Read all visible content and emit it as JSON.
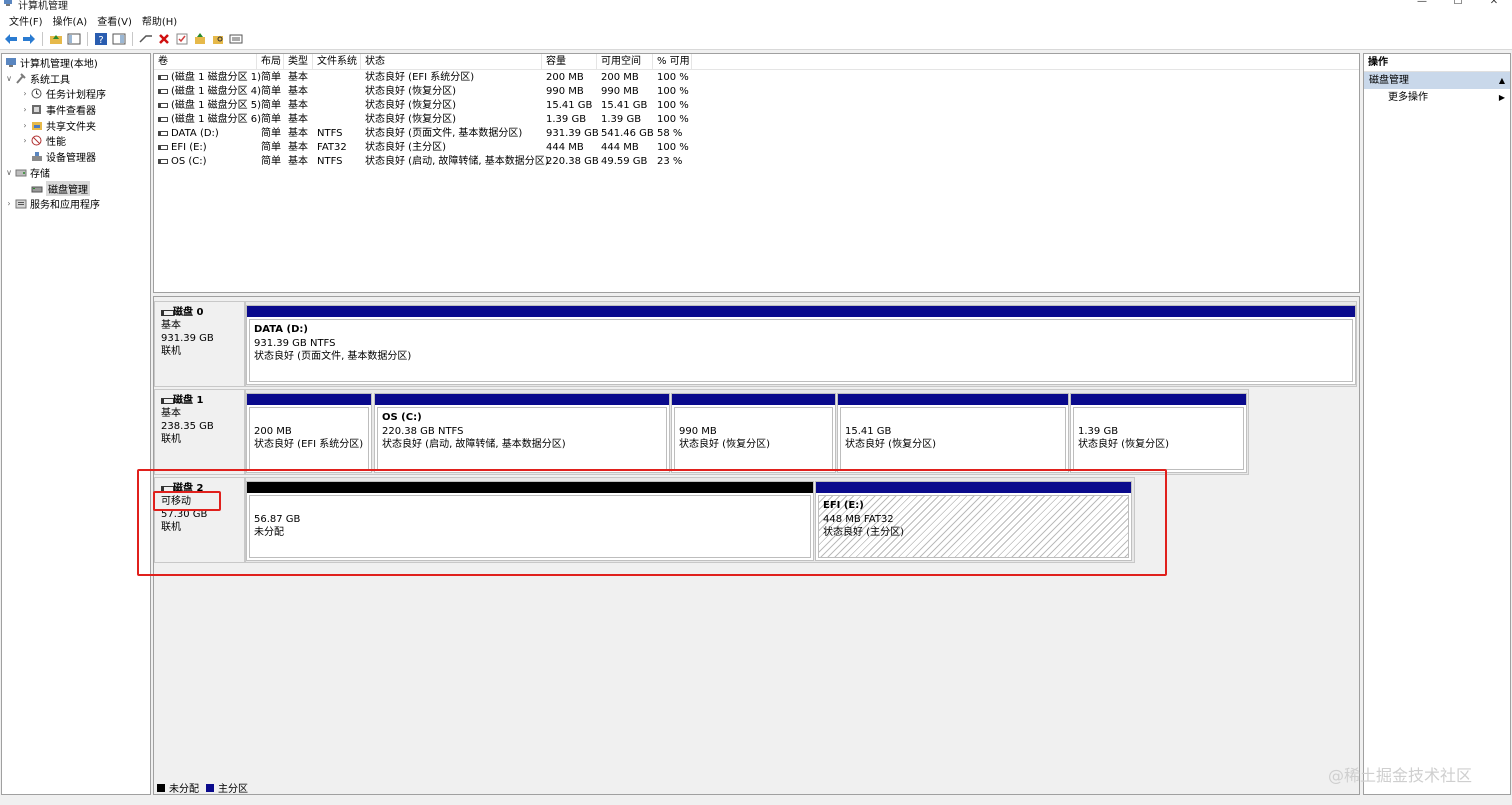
{
  "window": {
    "title": "计算机管理",
    "controls": [
      "—",
      "☐",
      "✕"
    ]
  },
  "menu": [
    "文件(F)",
    "操作(A)",
    "查看(V)",
    "帮助(H)"
  ],
  "tree": {
    "root": "计算机管理(本地)",
    "system_tools": "系统工具",
    "task_scheduler": "任务计划程序",
    "event_viewer": "事件查看器",
    "shared_folders": "共享文件夹",
    "performance": "性能",
    "device_manager": "设备管理器",
    "storage": "存储",
    "disk_management": "磁盘管理",
    "services_apps": "服务和应用程序"
  },
  "volumes": {
    "headers": [
      "卷",
      "布局",
      "类型",
      "文件系统",
      "状态",
      "容量",
      "可用空间",
      "% 可用"
    ],
    "rows": [
      [
        "(磁盘 1 磁盘分区 1)",
        "简单",
        "基本",
        "",
        "状态良好 (EFI 系统分区)",
        "200 MB",
        "200 MB",
        "100 %"
      ],
      [
        "(磁盘 1 磁盘分区 4)",
        "简单",
        "基本",
        "",
        "状态良好 (恢复分区)",
        "990 MB",
        "990 MB",
        "100 %"
      ],
      [
        "(磁盘 1 磁盘分区 5)",
        "简单",
        "基本",
        "",
        "状态良好 (恢复分区)",
        "15.41 GB",
        "15.41 GB",
        "100 %"
      ],
      [
        "(磁盘 1 磁盘分区 6)",
        "简单",
        "基本",
        "",
        "状态良好 (恢复分区)",
        "1.39 GB",
        "1.39 GB",
        "100 %"
      ],
      [
        "DATA (D:)",
        "简单",
        "基本",
        "NTFS",
        "状态良好 (页面文件, 基本数据分区)",
        "931.39 GB",
        "541.46 GB",
        "58 %"
      ],
      [
        "EFI (E:)",
        "简单",
        "基本",
        "FAT32",
        "状态良好 (主分区)",
        "444 MB",
        "444 MB",
        "100 %"
      ],
      [
        "OS (C:)",
        "简单",
        "基本",
        "NTFS",
        "状态良好 (启动, 故障转储, 基本数据分区)",
        "220.38 GB",
        "49.59 GB",
        "23 %"
      ]
    ]
  },
  "disks": {
    "disk0": {
      "name": "磁盘 0",
      "type": "基本",
      "size": "931.39 GB",
      "status": "联机",
      "parts": [
        {
          "name": "DATA  (D:)",
          "size": "931.39 GB NTFS",
          "status": "状态良好 (页面文件, 基本数据分区)"
        }
      ]
    },
    "disk1": {
      "name": "磁盘 1",
      "type": "基本",
      "size": "238.35 GB",
      "status": "联机",
      "parts": [
        {
          "name": "",
          "size": "200 MB",
          "status": "状态良好 (EFI 系统分区)"
        },
        {
          "name": "OS  (C:)",
          "size": "220.38 GB NTFS",
          "status": "状态良好 (启动, 故障转储, 基本数据分区)"
        },
        {
          "name": "",
          "size": "990 MB",
          "status": "状态良好 (恢复分区)"
        },
        {
          "name": "",
          "size": "15.41 GB",
          "status": "状态良好 (恢复分区)"
        },
        {
          "name": "",
          "size": "1.39 GB",
          "status": "状态良好 (恢复分区)"
        }
      ]
    },
    "disk2": {
      "name": "磁盘 2",
      "type": "可移动",
      "size": "57.30 GB",
      "status": "联机",
      "parts": [
        {
          "name": "",
          "size": "56.87 GB",
          "status": "未分配"
        },
        {
          "name": "EFI  (E:)",
          "size": "448 MB FAT32",
          "status": "状态良好 (主分区)"
        }
      ]
    }
  },
  "legend": {
    "unallocated": "未分配",
    "primary": "主分区"
  },
  "actions": {
    "title": "操作",
    "section": "磁盘管理",
    "more": "更多操作"
  },
  "watermark": "@稀土掘金技术社区",
  "colors": {
    "primary_bar": "#0a0a8c",
    "unallocated_bar": "#000000",
    "highlight": "#e0201c",
    "selected_section": "#c9d8ea"
  }
}
